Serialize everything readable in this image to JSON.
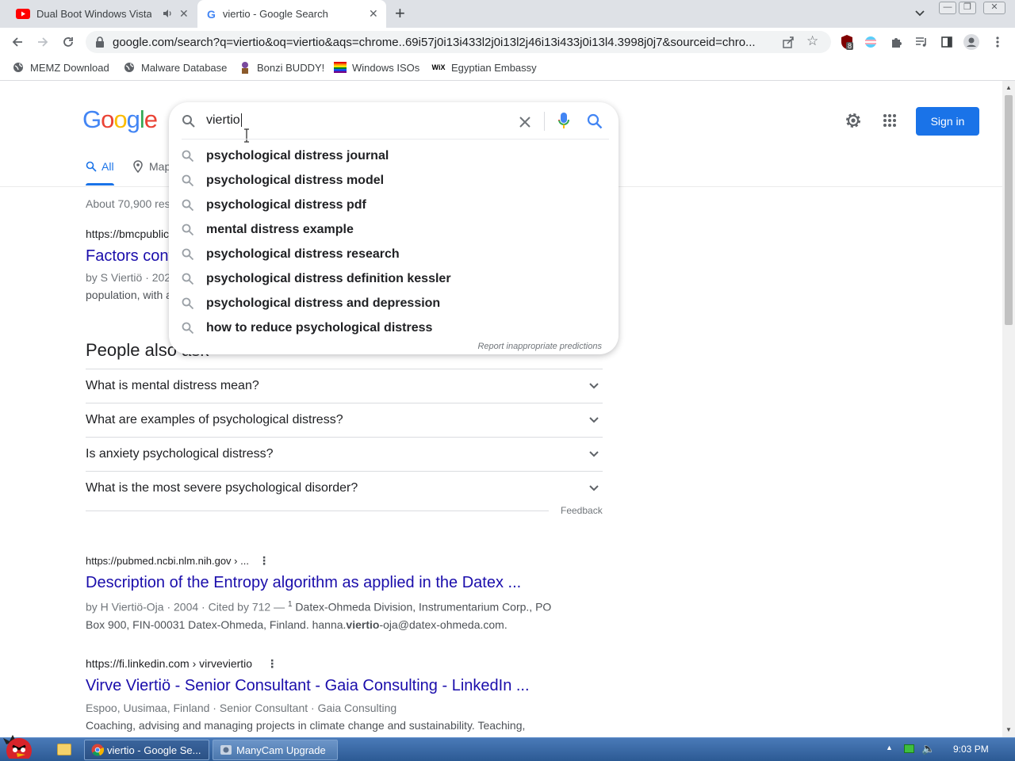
{
  "browser": {
    "tabs": [
      {
        "title": "Dual Boot Windows Vista",
        "audio": true,
        "active": false
      },
      {
        "title": "viertio - Google Search",
        "active": true
      }
    ],
    "url": "google.com/search?q=viertio&oq=viertio&aqs=chrome..69i57j0i13i433l2j0i13l2j46i13i433j0i13l4.3998j0j7&sourceid=chro...",
    "extension_badge": "8",
    "bookmarks": [
      {
        "label": "MEMZ Download",
        "icon": "globe-icon"
      },
      {
        "label": "Malware Database",
        "icon": "globe-icon"
      },
      {
        "label": "Bonzi BUDDY!",
        "icon": "bonzi-icon"
      },
      {
        "label": "Windows ISOs",
        "icon": "rainbow-flag-icon"
      },
      {
        "label": "Egyptian Embassy",
        "icon": "wix-icon"
      }
    ]
  },
  "google": {
    "search_query": "viertio",
    "suggestions": [
      "psychological distress journal",
      "psychological distress model",
      "psychological distress pdf",
      "mental distress example",
      "psychological distress research",
      "psychological distress definition kessler",
      "psychological distress and depression",
      "how to reduce psychological distress"
    ],
    "report_text": "Report inappropriate predictions",
    "sign_in": "Sign in",
    "tabs": [
      {
        "label": "All"
      },
      {
        "label": "Maps"
      }
    ],
    "result_stats": "About 70,900 results",
    "first_result": {
      "cite": "https://bmcpublichealth...",
      "title": "Factors contributing to...",
      "byline": "by S Viertiö · 2021",
      "snippet": "population, with a..."
    },
    "people_also_ask": {
      "title": "People also ask",
      "questions": [
        "What is mental distress mean?",
        "What are examples of psychological distress?",
        "Is anxiety psychological distress?",
        "What is the most severe psychological disorder?"
      ],
      "feedback": "Feedback"
    },
    "results": [
      {
        "cite": "https://pubmed.ncbi.nlm.nih.gov › ...",
        "title": "Description of the Entropy algorithm as applied in the Datex ...",
        "meta": "by H Viertiö-Oja · 2004 · Cited by 712 — ",
        "sup": "1",
        "line1": " Datex-Ohmeda Division, Instrumentarium Corp., PO",
        "line2_pre": "Box 900, FIN-00031 Datex-Ohmeda, Finland. hanna.",
        "line2_bold": "viertio",
        "line2_post": "-oja@datex-ohmeda.com."
      },
      {
        "cite": "https://fi.linkedin.com › virveviertio",
        "title": "Virve Viertiö - Senior Consultant - Gaia Consulting - LinkedIn ...",
        "meta": "Espoo, Uusimaa, Finland · Senior Consultant · Gaia Consulting",
        "line2": "Coaching, advising and managing projects in climate change and sustainability. Teaching,"
      }
    ]
  },
  "taskbar": {
    "items": [
      {
        "label": "viertio - Google Se...",
        "icon": "chrome-icon"
      },
      {
        "label": "ManyCam Upgrade",
        "icon": "manycam-icon"
      }
    ],
    "clock": "9:03 PM"
  },
  "colors": {
    "accent": "#1a73e8",
    "link": "#1a0dab",
    "tabstrip": "#dee1e6"
  }
}
